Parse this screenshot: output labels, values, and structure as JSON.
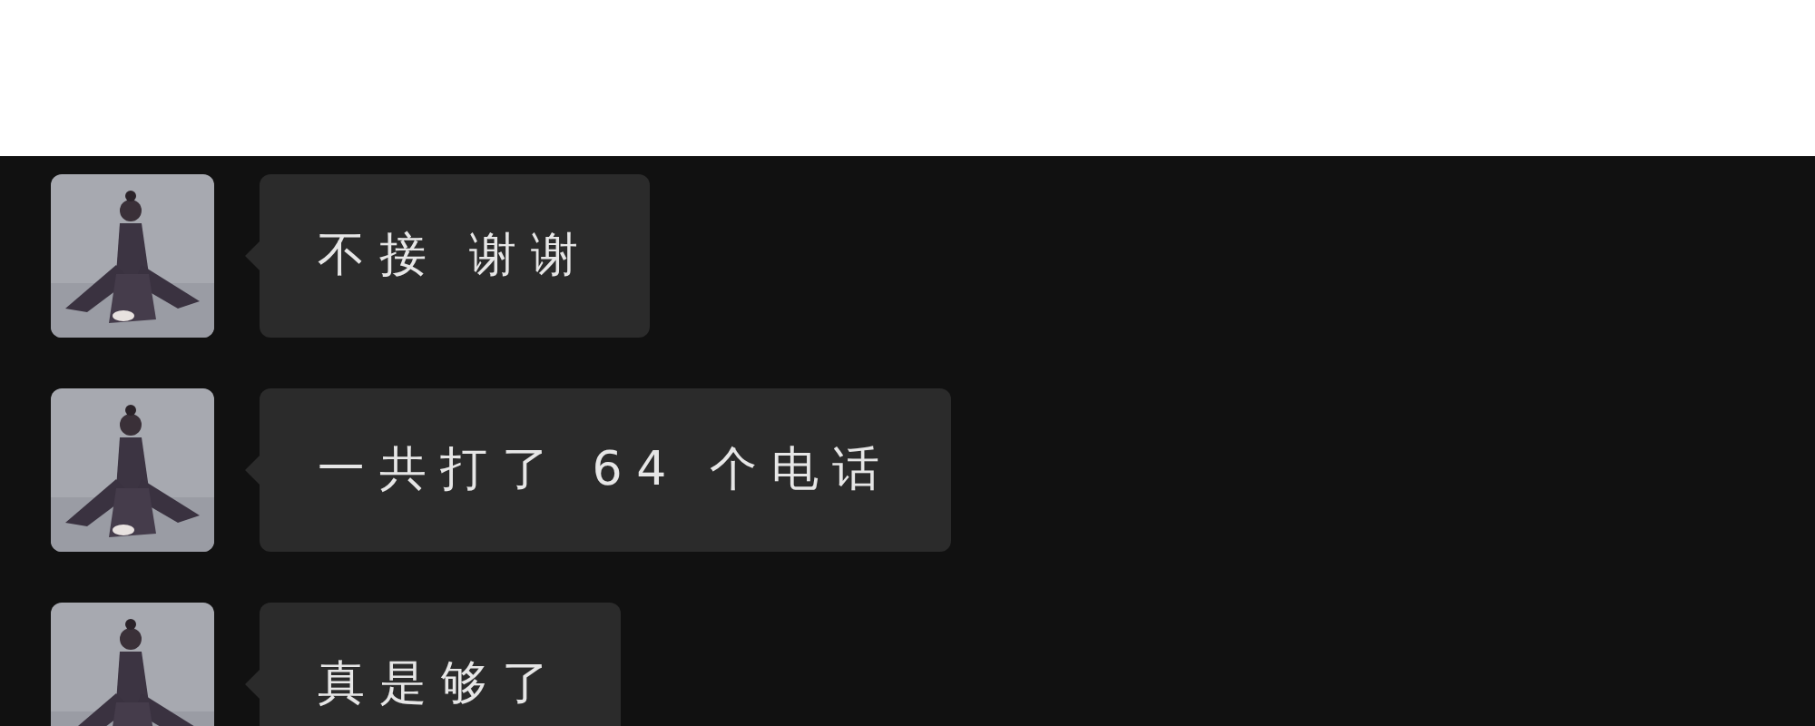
{
  "messages": [
    {
      "text": "不接 谢谢"
    },
    {
      "text": "一共打了 64 个电话"
    },
    {
      "text": "真是够了"
    }
  ]
}
